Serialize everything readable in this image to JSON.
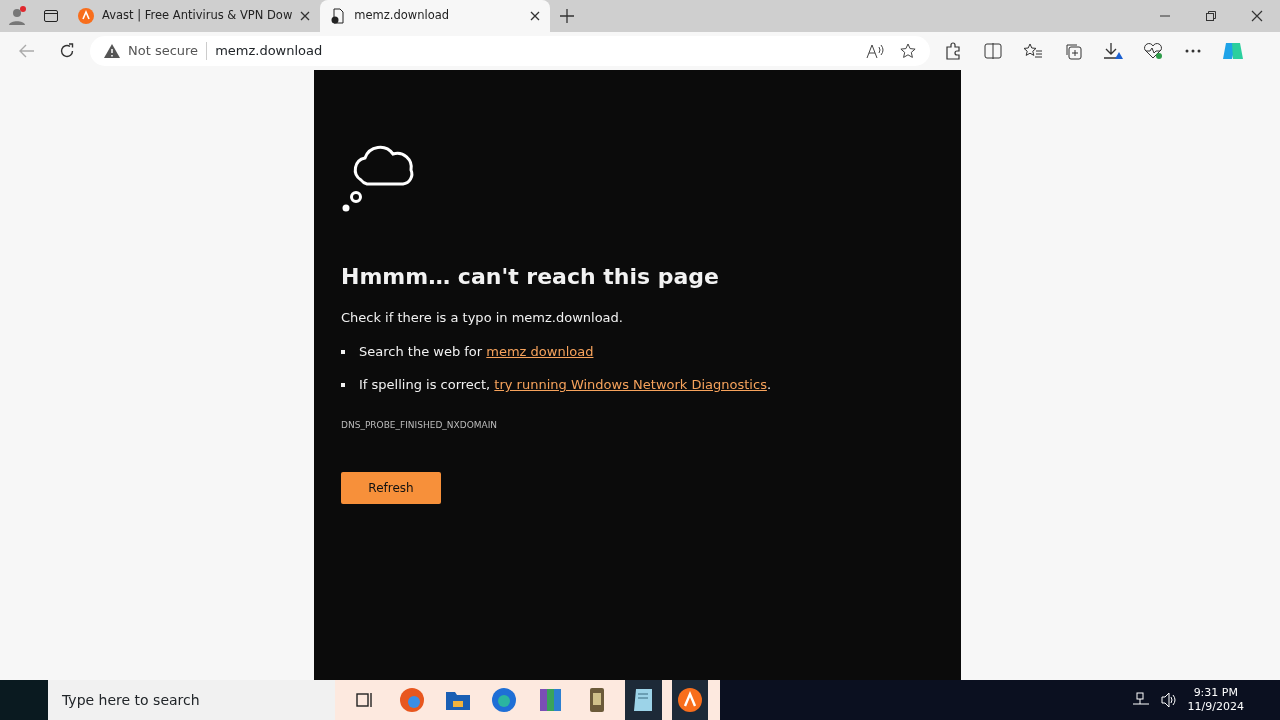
{
  "browser": {
    "tabs": [
      {
        "title": "Avast | Free Antivirus & VPN Dow",
        "selected": false
      },
      {
        "title": "memz.download",
        "selected": true
      }
    ],
    "address": {
      "security": "Not secure",
      "url": "memz.download"
    }
  },
  "error_page": {
    "heading": "Hmmm… can't reach this page",
    "message": "Check if there is a typo in memz.download.",
    "suggestions": [
      {
        "text": "Search the web for ",
        "link": "memz download"
      },
      {
        "text": "If spelling is correct, ",
        "link": "try running Windows Network Diagnostics",
        "after": "."
      }
    ],
    "error_code": "DNS_PROBE_FINISHED_NXDOMAIN",
    "button": "Refresh"
  },
  "taskbar": {
    "search_placeholder": "Type here to search",
    "time": "9:31 PM",
    "date": "11/9/2024"
  }
}
